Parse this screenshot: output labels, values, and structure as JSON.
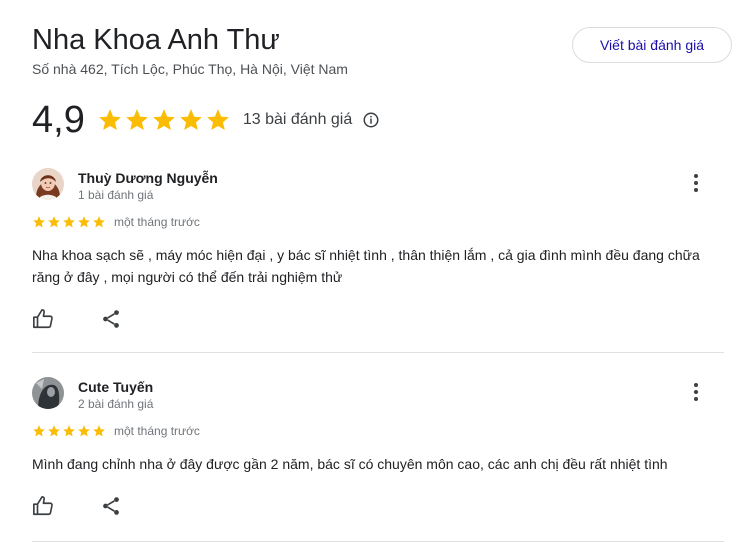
{
  "place": {
    "name": "Nha Khoa Anh Thư",
    "address": "Số nhà 462, Tích Lộc, Phúc Thọ, Hà Nội, Việt Nam",
    "write_review_label": "Viết bài đánh giá"
  },
  "summary": {
    "rating": "4,9",
    "stars": 5,
    "review_count": "13 bài đánh giá",
    "info_icon": "info-icon"
  },
  "reviews": [
    {
      "author": "Thuỳ Dương Nguyễn",
      "author_meta": "1 bài đánh giá",
      "stars": 5,
      "date": "một tháng trước",
      "text": "Nha khoa sạch sẽ , máy móc hiện đại , y bác sĩ nhiệt tình , thân thiện lắm , cả gia đình mình đều đang chữa răng ở đây , mọi người có thể đến trải nghiệm thử"
    },
    {
      "author": "Cute Tuyến",
      "author_meta": "2 bài đánh giá",
      "stars": 5,
      "date": "một tháng trước",
      "text": "Mình đang chỉnh nha ở đây được gần 2 năm, bác sĩ có chuyên môn cao, các anh chị đều rất nhiệt tình"
    }
  ],
  "colors": {
    "star": "#fbbc04",
    "link": "#1a0dab",
    "muted": "#70757a",
    "divider": "#e0e0e0"
  }
}
